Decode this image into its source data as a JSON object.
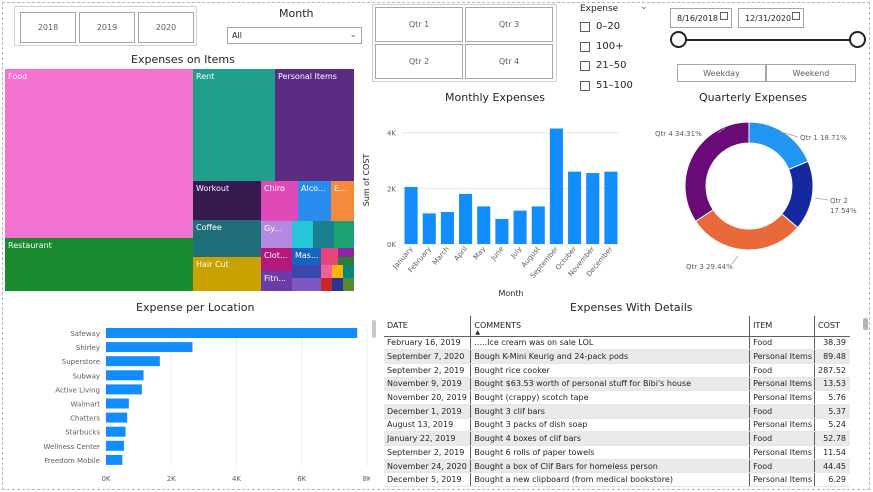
{
  "years": [
    "2018",
    "2019",
    "2020"
  ],
  "month": {
    "label": "Month",
    "selected": "All"
  },
  "quarters": [
    "Qtr 1",
    "Qtr 3",
    "Qtr 2",
    "Qtr 4"
  ],
  "expense_filter": {
    "label": "Expense",
    "options": [
      "0–20",
      "100+",
      "21–50",
      "51–100"
    ]
  },
  "date_range": {
    "start": "8/16/2018",
    "end": "12/31/2020",
    "start_fraction": 0.0,
    "end_fraction": 1.0
  },
  "day_buttons": [
    "Weekday",
    "Weekend"
  ],
  "treemap": {
    "title": "Expenses on Items",
    "items": [
      {
        "label": "Food",
        "color": "#f472d0"
      },
      {
        "label": "Restaurant",
        "color": "#1a8a2e"
      },
      {
        "label": "Rent",
        "color": "#1f9f8c"
      },
      {
        "label": "Personal Items",
        "color": "#5a2d82"
      },
      {
        "label": "Workout",
        "color": "#341a4f"
      },
      {
        "label": "Coffee",
        "color": "#1e6f7a"
      },
      {
        "label": "Hair Cut",
        "color": "#c9a100"
      },
      {
        "label": "Chiro",
        "color": "#e04ab6"
      },
      {
        "label": "Alco...",
        "color": "#2a8cf0"
      },
      {
        "label": "E...",
        "color": "#f58a3c"
      },
      {
        "label": "Gy...",
        "color": "#b48ae0"
      },
      {
        "label": "Clot...",
        "color": "#b5187c"
      },
      {
        "label": "Mas...",
        "color": "#1565c0"
      },
      {
        "label": "Fitn...",
        "color": "#6a3ca8"
      }
    ]
  },
  "monthly": {
    "title": "Monthly Expenses",
    "chart_data": {
      "type": "bar",
      "categories": [
        "January",
        "February",
        "March",
        "April",
        "May",
        "June",
        "July",
        "August",
        "September",
        "October",
        "November",
        "December"
      ],
      "values": [
        2050,
        1100,
        1150,
        1800,
        1350,
        900,
        1200,
        1350,
        4150,
        2600,
        2550,
        2600
      ],
      "xlabel": "Month",
      "ylabel": "Sum of COST",
      "yticks": [
        "0K",
        "2K",
        "4K"
      ],
      "ylim": [
        0,
        4600
      ]
    }
  },
  "quarterly": {
    "title": "Quarterly Expenses",
    "chart_data": {
      "type": "pie",
      "labels": [
        "Qtr 1",
        "Qtr 2",
        "Qtr 3",
        "Qtr 4"
      ],
      "values": [
        18.71,
        17.54,
        29.44,
        34.31
      ],
      "display": [
        "Qtr 1 18.71%",
        "Qtr 2",
        "17.54%",
        "Qtr 3 29.44%",
        "Qtr 4 34.31%"
      ],
      "colors": [
        "#2196f3",
        "#1428a0",
        "#e8693a",
        "#6a0a78"
      ]
    }
  },
  "location": {
    "title": "Expense per Location",
    "chart_data": {
      "type": "bar",
      "categories": [
        "Safeway",
        "Shirley",
        "Superstore",
        "Subway",
        "Active Living",
        "Walmart",
        "Chatters",
        "Starbucks",
        "Wellness Center",
        "Freedom Mobile"
      ],
      "values": [
        7700,
        2650,
        1650,
        1150,
        1100,
        700,
        650,
        600,
        550,
        500
      ],
      "xticks": [
        "0K",
        "2K",
        "4K",
        "6K",
        "8K"
      ],
      "xlim": [
        0,
        8000
      ]
    }
  },
  "details": {
    "title": "Expenses With Details",
    "columns": [
      "DATE",
      "COMMENTS",
      "ITEM",
      "COST"
    ],
    "rows": [
      [
        "February 16, 2019",
        ".....Ice cream was on sale LOL",
        "Food",
        "38.39"
      ],
      [
        "September 7, 2020",
        "Bough K-Mini Keurig and 24-pack pods",
        "Personal Items",
        "89.48"
      ],
      [
        "September 2, 2019",
        "Bought rice cooker",
        "Food",
        "287.52"
      ],
      [
        "November 9, 2019",
        "Bought $63.53 worth of personal stuff for Bibi's house",
        "Personal Items",
        "13.53"
      ],
      [
        "November 20, 2019",
        "Bought (crappy) scotch tape",
        "Personal Items",
        "5.76"
      ],
      [
        "December 1, 2019",
        "Bought 3 clif bars",
        "Food",
        "5.37"
      ],
      [
        "August 13, 2019",
        "Bought 3 packs of dish soap",
        "Personal Items",
        "5.24"
      ],
      [
        "January 22, 2019",
        "Bought 4 boxes of clif bars",
        "Food",
        "52.78"
      ],
      [
        "September 2, 2019",
        "Bought 6 rolls of paper towels",
        "Personal Items",
        "11.54"
      ],
      [
        "November 24, 2020",
        "Bought a box of Clif Bars for homeless person",
        "Food",
        "44.45"
      ],
      [
        "December 5, 2019",
        "Bought a new clipboard (from medical bookstore)",
        "Personal Items",
        "6.29"
      ]
    ]
  }
}
